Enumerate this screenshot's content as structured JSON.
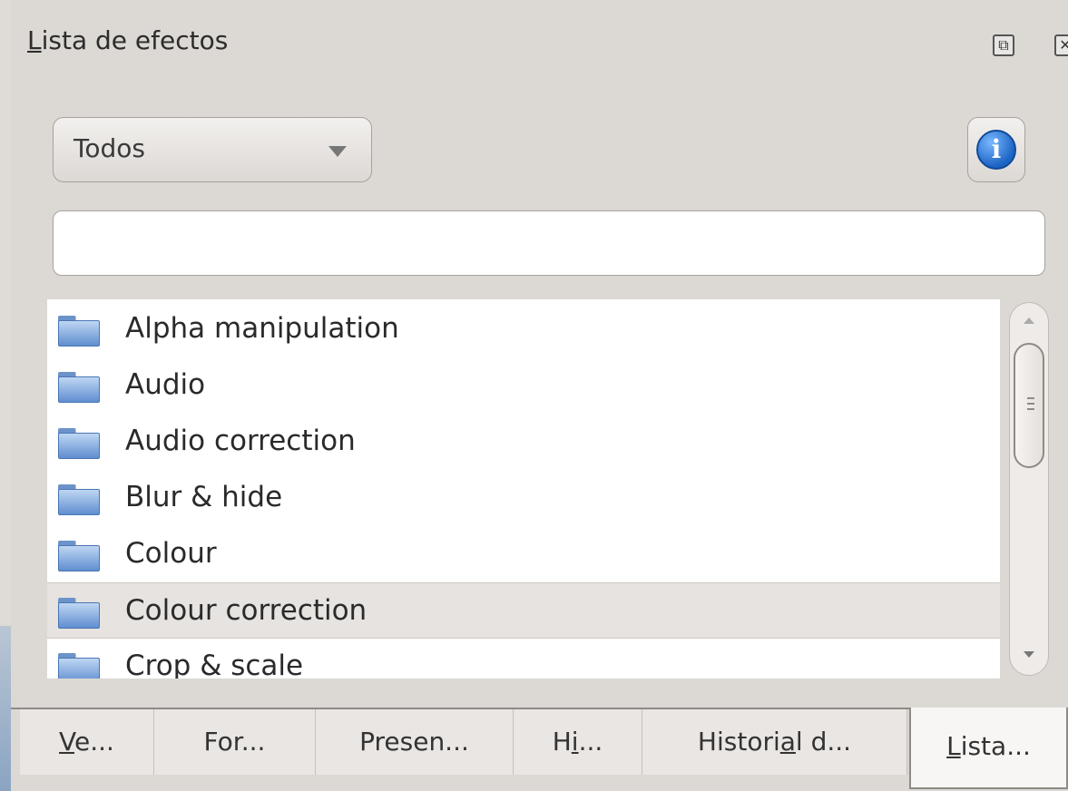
{
  "panel": {
    "title_prefix": "L",
    "title_rest": "ista de efectos",
    "float_icon": "float-window-icon",
    "close_icon": "close-icon"
  },
  "filter": {
    "selected": "Todos",
    "arrow_icon": "dropdown-arrow-icon"
  },
  "info_button": {
    "icon": "info-icon",
    "glyph": "i"
  },
  "search": {
    "value": "",
    "placeholder": ""
  },
  "effects_list": {
    "folder_icon": "folder-icon",
    "items": [
      {
        "label": "Alpha manipulation"
      },
      {
        "label": "Audio"
      },
      {
        "label": "Audio correction"
      },
      {
        "label": "Blur & hide"
      },
      {
        "label": "Colour"
      },
      {
        "label": "Colour correction",
        "selected": true
      },
      {
        "label": "Crop & scale"
      }
    ]
  },
  "tabs": [
    {
      "pre": "",
      "ul": "V",
      "post": "e..."
    },
    {
      "pre": "For...",
      "ul": "",
      "post": ""
    },
    {
      "pre": "Presen...",
      "ul": "",
      "post": ""
    },
    {
      "pre": "H",
      "ul": "i",
      "post": "..."
    },
    {
      "pre": "Histori",
      "ul": "a",
      "post": "l d..."
    },
    {
      "pre": "",
      "ul": "L",
      "post": "ista...",
      "active": true
    }
  ]
}
